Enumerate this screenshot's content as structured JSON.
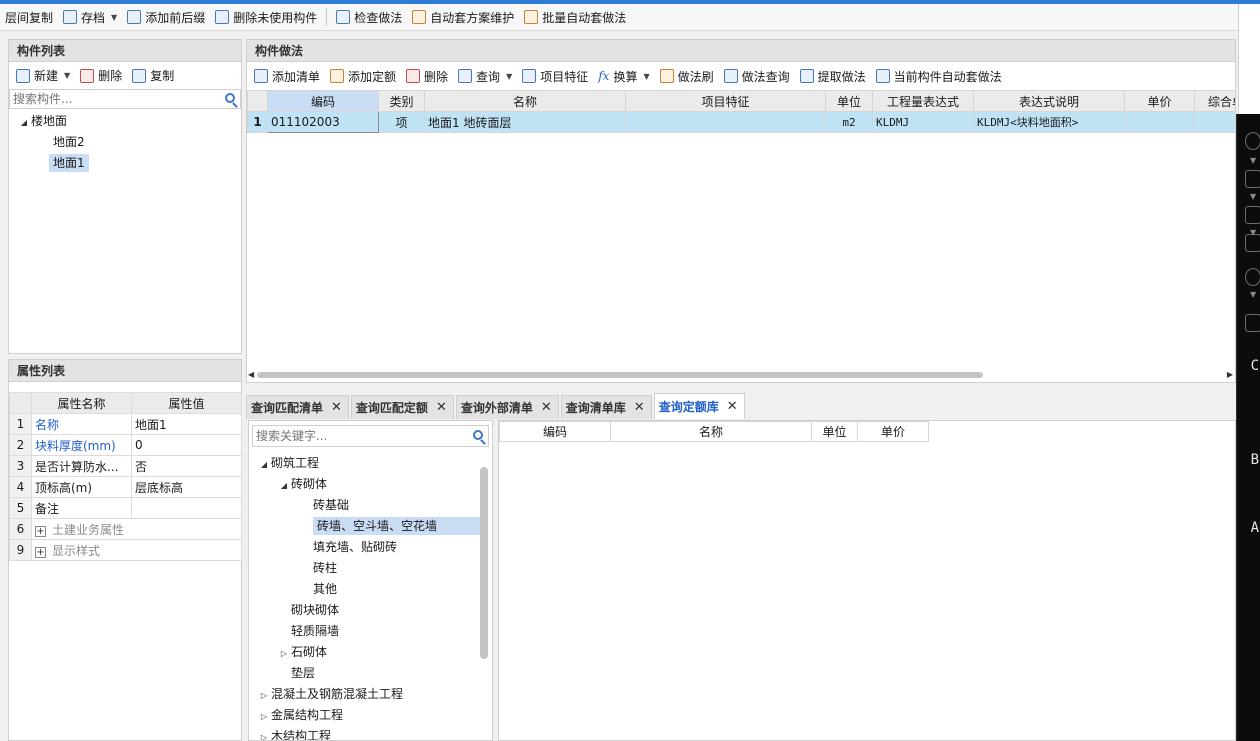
{
  "toolbar": {
    "items": [
      {
        "label": "层间复制",
        "icon": "copy-floors-icon"
      },
      {
        "label": "存档",
        "icon": "archive-icon"
      },
      {
        "label": "添加前后缀",
        "icon": "add-prefix-suffix-icon"
      },
      {
        "label": "删除未使用构件",
        "icon": "delete-unused-icon"
      },
      {
        "label": "检查做法",
        "icon": "check-method-icon"
      },
      {
        "label": "自动套方案维护",
        "icon": "auto-scheme-icon"
      },
      {
        "label": "批量自动套做法",
        "icon": "batch-auto-icon"
      }
    ]
  },
  "component_list": {
    "title": "构件列表",
    "new_label": "新建",
    "delete_label": "删除",
    "copy_label": "复制",
    "search_placeholder": "搜索构件...",
    "tree": {
      "root": "楼地面",
      "children": [
        "地面2",
        "地面1"
      ],
      "selected": "地面1"
    }
  },
  "attribute_list": {
    "title": "属性列表",
    "col_name": "属性名称",
    "col_value": "属性值",
    "rows": [
      {
        "num": "1",
        "name": "名称",
        "value": "地面1"
      },
      {
        "num": "2",
        "name": "块料厚度(mm)",
        "value": "0"
      },
      {
        "num": "3",
        "name": "是否计算防水...",
        "value": "否"
      },
      {
        "num": "4",
        "name": "顶标高(m)",
        "value": "层底标高"
      },
      {
        "num": "5",
        "name": "备注",
        "value": ""
      },
      {
        "num": "6",
        "name": "土建业务属性",
        "value": ""
      },
      {
        "num": "9",
        "name": "显示样式",
        "value": ""
      }
    ]
  },
  "method": {
    "title": "构件做法",
    "tools": {
      "add_list": "添加清单",
      "add_quota": "添加定额",
      "delete": "删除",
      "query": "查询",
      "feature": "项目特征",
      "convert": "换算",
      "brush": "做法刷",
      "method_query": "做法查询",
      "extract": "提取做法",
      "auto_current": "当前构件自动套做法"
    },
    "columns": [
      "编码",
      "类别",
      "名称",
      "项目特征",
      "单位",
      "工程量表达式",
      "表达式说明",
      "单价",
      "综合单"
    ],
    "rows": [
      {
        "num": "1",
        "code": "011102003",
        "type": "项",
        "name": "地面1 地砖面层",
        "feature": "",
        "unit": "m2",
        "expr": "KLDMJ",
        "expr_desc": "KLDMJ<块料地面积>",
        "price": "",
        "total": ""
      }
    ]
  },
  "query_tabs": [
    {
      "label": "查询匹配清单",
      "active": false
    },
    {
      "label": "查询匹配定额",
      "active": false
    },
    {
      "label": "查询外部清单",
      "active": false
    },
    {
      "label": "查询清单库",
      "active": false
    },
    {
      "label": "查询定额库",
      "active": true
    }
  ],
  "quota_tree": {
    "search_placeholder": "搜索关键字...",
    "items": [
      {
        "label": "砌筑工程",
        "level": 0,
        "toggle": "expanded"
      },
      {
        "label": "砖砌体",
        "level": 1,
        "toggle": "expanded"
      },
      {
        "label": "砖基础",
        "level": 2,
        "toggle": "none"
      },
      {
        "label": "砖墙、空斗墙、空花墙",
        "level": 2,
        "toggle": "none",
        "selected": true
      },
      {
        "label": "填充墙、贴砌砖",
        "level": 2,
        "toggle": "none"
      },
      {
        "label": "砖柱",
        "level": 2,
        "toggle": "none"
      },
      {
        "label": "其他",
        "level": 2,
        "toggle": "none"
      },
      {
        "label": "砌块砌体",
        "level": 1,
        "toggle": "none"
      },
      {
        "label": "轻质隔墙",
        "level": 1,
        "toggle": "none"
      },
      {
        "label": "石砌体",
        "level": 1,
        "toggle": "collapsed"
      },
      {
        "label": "垫层",
        "level": 1,
        "toggle": "none"
      },
      {
        "label": "混凝土及钢筋混凝土工程",
        "level": 0,
        "toggle": "collapsed"
      },
      {
        "label": "金属结构工程",
        "level": 0,
        "toggle": "collapsed"
      },
      {
        "label": "木结构工程",
        "level": 0,
        "toggle": "collapsed"
      }
    ]
  },
  "quota_grid": {
    "columns": [
      "编码",
      "名称",
      "单位",
      "单价"
    ]
  },
  "cad": {
    "axes": [
      "C",
      "B",
      "A"
    ]
  },
  "colors": {
    "accent": "#2e7bd6",
    "selection": "#bfe3f5",
    "tree_selection": "#c9ddf5",
    "link_blue": "#2060c8"
  }
}
